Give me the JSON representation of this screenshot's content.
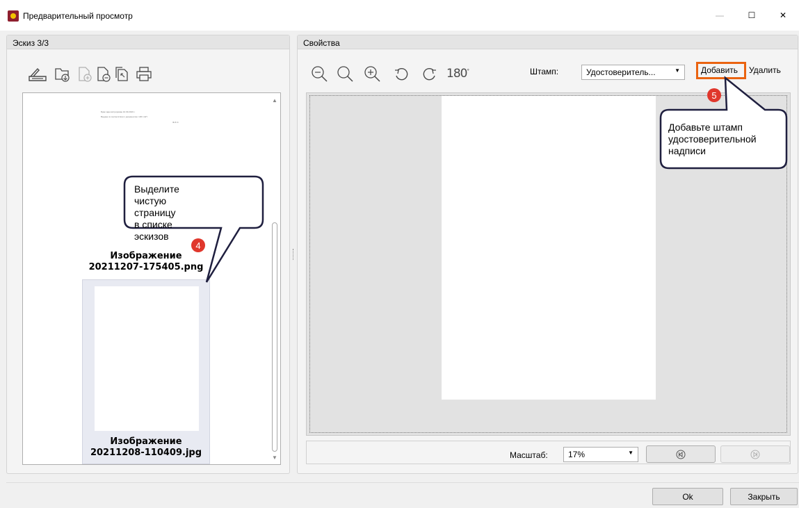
{
  "window": {
    "title": "Предварительный просмотр",
    "controls": {
      "minimize": "—",
      "maximize": "☐",
      "close": "✕"
    }
  },
  "left_panel": {
    "header": "Эскиз 3/3",
    "toolbar": [
      "scanner-icon",
      "import-folder-icon",
      "add-page-icon",
      "remove-page-icon",
      "copy-pages-icon",
      "print-icon"
    ],
    "thumbnails": [
      {
        "caption_line1": "Изображение",
        "caption_line2": "20211207-175405.png",
        "selected": false
      },
      {
        "caption_line1": "Изображение",
        "caption_line2": "20211208-110409.jpg",
        "selected": true
      }
    ],
    "page_text_lines": [
      "Брак зарегистрирован 10.09.2019 г.",
      "Выдано в соответствии с документом: 136 1 ЕП",
      "Ф.И.О."
    ]
  },
  "right_panel": {
    "header": "Свойства",
    "toolbar": [
      "zoom-out-icon",
      "zoom-fit-icon",
      "zoom-in-icon",
      "rotate-left-icon",
      "rotate-right-icon",
      "rotate-180-icon"
    ],
    "rotate_180_label": "180",
    "stamp_label": "Штамп:",
    "stamp_value": "Удостоверитель...",
    "add_label": "Добавить",
    "delete_label": "Удалить",
    "scale_label": "Масштаб:",
    "scale_value": "17%"
  },
  "buttons": {
    "ok": "Ok",
    "close": "Закрыть"
  },
  "callouts": [
    {
      "step": "4",
      "text": [
        "Выделите чистую",
        "страницу в списке",
        "эскизов"
      ]
    },
    {
      "step": "5",
      "text": [
        "Добавьте штамп",
        "удостоверительной",
        "надписи"
      ]
    }
  ],
  "colors": {
    "highlight": "#ea6310",
    "badge": "#e0372c",
    "callout_border": "#1f1f3f"
  }
}
